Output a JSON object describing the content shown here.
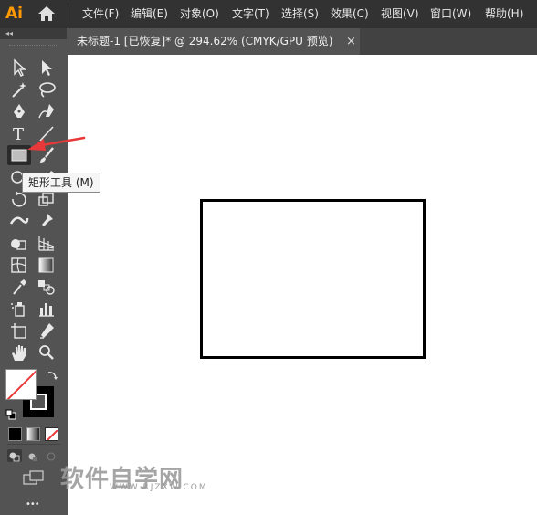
{
  "app": {
    "logo": "Ai",
    "home_icon": "home-icon"
  },
  "menu": {
    "items": [
      "文件(F)",
      "编辑(E)",
      "对象(O)",
      "文字(T)",
      "选择(S)",
      "效果(C)",
      "视图(V)",
      "窗口(W)",
      "帮助(H)"
    ]
  },
  "document_tab": {
    "title": "未标题-1 [已恢复]* @ 294.62% (CMYK/GPU 预览)",
    "close": "×"
  },
  "toolbar": {
    "collapse": "◂◂",
    "more": "•••",
    "tools": [
      "selection-tool-icon",
      "direct-selection-tool-icon",
      "magic-wand-tool-icon",
      "lasso-tool-icon",
      "pen-tool-icon",
      "curvature-tool-icon",
      "type-tool-icon",
      "line-segment-tool-icon",
      "rectangle-tool-icon",
      "paintbrush-tool-icon",
      "ellipse-tool-icon",
      "pencil-tool-icon",
      "rotate-tool-icon",
      "scale-tool-icon",
      "width-tool-icon",
      "puppet-warp-tool-icon",
      "shape-builder-tool-icon",
      "perspective-grid-tool-icon",
      "mesh-tool-icon",
      "gradient-tool-icon",
      "eyedropper-tool-icon",
      "blend-tool-icon",
      "symbol-sprayer-tool-icon",
      "column-graph-tool-icon",
      "artboard-tool-icon",
      "slice-tool-icon",
      "hand-tool-icon",
      "zoom-tool-icon"
    ]
  },
  "tooltip": {
    "text": "矩形工具 (M)"
  },
  "colors": {
    "fill": "#ffffff",
    "stroke": "#000000",
    "accent_arrow": "#e8393a",
    "logo": "#ff9a00"
  },
  "watermark": {
    "brand": "软件自学网",
    "url": "WWW.RJZXW.COM"
  }
}
